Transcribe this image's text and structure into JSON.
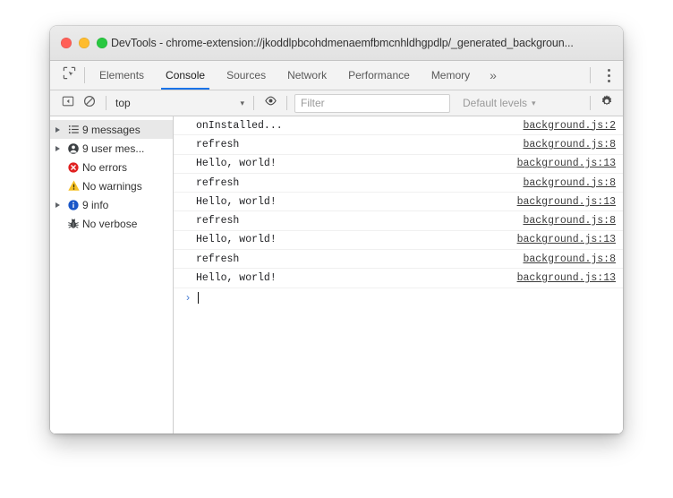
{
  "window": {
    "title": "DevTools - chrome-extension://jkoddlpbcohdmenaemfbmcnhldhgpdlp/_generated_backgroun...",
    "traffic_lights": {
      "close_label": "close",
      "minimize_label": "minimize",
      "zoom_label": "zoom",
      "close_color": "#ff5f57",
      "minimize_color": "#febc2e",
      "zoom_color": "#28c840"
    }
  },
  "tabbar": {
    "inspect_icon": "inspect-element-icon",
    "tabs": [
      {
        "label": "Elements",
        "active": false
      },
      {
        "label": "Console",
        "active": true
      },
      {
        "label": "Sources",
        "active": false
      },
      {
        "label": "Network",
        "active": false
      },
      {
        "label": "Performance",
        "active": false
      },
      {
        "label": "Memory",
        "active": false
      }
    ],
    "overflow_label": "»",
    "menu_icon": "kebab-menu-icon",
    "active_underline_color": "#1a73e8"
  },
  "console_toolbar": {
    "sidebar_toggle_icon": "sidebar-toggle-icon",
    "clear_icon": "clear-console-icon",
    "context": {
      "value": "top",
      "caret": "▾"
    },
    "eye_icon": "live-expression-eye-icon",
    "filter": {
      "value": "",
      "placeholder": "Filter"
    },
    "levels": {
      "label": "Default levels",
      "caret": "▾"
    },
    "settings_icon": "gear-icon"
  },
  "sidebar": {
    "items": [
      {
        "label": "9 messages",
        "icon": "list-icon",
        "expandable": true,
        "selected": true
      },
      {
        "label": "9 user mes...",
        "icon": "person-icon",
        "expandable": true,
        "selected": false
      },
      {
        "label": "No errors",
        "icon": "error-icon",
        "expandable": false,
        "selected": false
      },
      {
        "label": "No warnings",
        "icon": "warning-icon",
        "expandable": false,
        "selected": false
      },
      {
        "label": "9 info",
        "icon": "info-icon",
        "expandable": true,
        "selected": false
      },
      {
        "label": "No verbose",
        "icon": "bug-icon",
        "expandable": false,
        "selected": false
      }
    ],
    "colors": {
      "error": "#e02020",
      "warning": "#f5c026",
      "info": "#1a56c7",
      "selected_row": "#e8e8e8"
    }
  },
  "console": {
    "messages": [
      {
        "text": "onInstalled...",
        "source": "background.js:2"
      },
      {
        "text": "refresh",
        "source": "background.js:8"
      },
      {
        "text": "Hello, world!",
        "source": "background.js:13"
      },
      {
        "text": "refresh",
        "source": "background.js:8"
      },
      {
        "text": "Hello, world!",
        "source": "background.js:13"
      },
      {
        "text": "refresh",
        "source": "background.js:8"
      },
      {
        "text": "Hello, world!",
        "source": "background.js:13"
      },
      {
        "text": "refresh",
        "source": "background.js:8"
      },
      {
        "text": "Hello, world!",
        "source": "background.js:13"
      }
    ],
    "prompt": {
      "chevron": "›",
      "input_value": ""
    }
  }
}
